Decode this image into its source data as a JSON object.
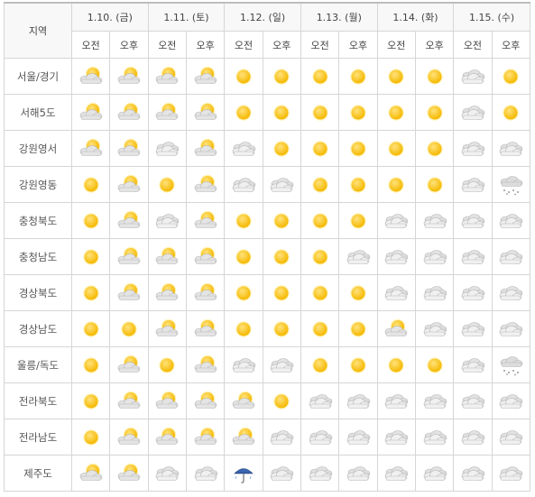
{
  "header": {
    "region_label": "지역",
    "days": [
      "1.10. (금)",
      "1.11. (토)",
      "1.12. (일)",
      "1.13. (월)",
      "1.14. (화)",
      "1.15. (수)"
    ],
    "am_label": "오전",
    "pm_label": "오후"
  },
  "icon_legend": {
    "sun": "sun-icon",
    "partly": "partly-cloudy-icon",
    "cloudy": "cloudy-icon",
    "snow": "snow-cloud-icon",
    "rain": "rain-umbrella-icon"
  },
  "colors": {
    "sun": "#f5b800",
    "cloud": "#d8d8d8",
    "border": "#d6d6d6",
    "umbrella": "#3a66b0"
  },
  "rows": [
    {
      "region": "서울/경기",
      "cells": [
        "partly",
        "partly",
        "partly",
        "partly",
        "sun",
        "sun",
        "sun",
        "sun",
        "sun",
        "sun",
        "cloudy",
        "sun"
      ]
    },
    {
      "region": "서해5도",
      "cells": [
        "partly",
        "partly",
        "partly",
        "partly",
        "sun",
        "sun",
        "sun",
        "sun",
        "sun",
        "sun",
        "cloudy",
        "sun"
      ]
    },
    {
      "region": "강원영서",
      "cells": [
        "partly",
        "partly",
        "cloudy",
        "partly",
        "cloudy",
        "sun",
        "sun",
        "sun",
        "sun",
        "sun",
        "cloudy",
        "cloudy"
      ]
    },
    {
      "region": "강원영동",
      "cells": [
        "sun",
        "partly",
        "sun",
        "partly",
        "cloudy",
        "cloudy",
        "sun",
        "sun",
        "sun",
        "sun",
        "cloudy",
        "snow"
      ]
    },
    {
      "region": "충청북도",
      "cells": [
        "sun",
        "partly",
        "cloudy",
        "partly",
        "sun",
        "sun",
        "sun",
        "sun",
        "cloudy",
        "cloudy",
        "cloudy",
        "cloudy"
      ]
    },
    {
      "region": "충청남도",
      "cells": [
        "sun",
        "partly",
        "partly",
        "partly",
        "sun",
        "sun",
        "sun",
        "cloudy",
        "cloudy",
        "cloudy",
        "cloudy",
        "cloudy"
      ]
    },
    {
      "region": "경상북도",
      "cells": [
        "sun",
        "partly",
        "partly",
        "partly",
        "sun",
        "sun",
        "sun",
        "sun",
        "cloudy",
        "cloudy",
        "cloudy",
        "cloudy"
      ]
    },
    {
      "region": "경상남도",
      "cells": [
        "sun",
        "sun",
        "partly",
        "partly",
        "sun",
        "sun",
        "sun",
        "sun",
        "partly",
        "cloudy",
        "cloudy",
        "cloudy"
      ]
    },
    {
      "region": "울릉/독도",
      "cells": [
        "sun",
        "partly",
        "sun",
        "partly",
        "cloudy",
        "cloudy",
        "sun",
        "sun",
        "sun",
        "sun",
        "cloudy",
        "snow"
      ]
    },
    {
      "region": "전라북도",
      "cells": [
        "sun",
        "partly",
        "partly",
        "partly",
        "partly",
        "sun",
        "cloudy",
        "cloudy",
        "cloudy",
        "cloudy",
        "cloudy",
        "cloudy"
      ]
    },
    {
      "region": "전라남도",
      "cells": [
        "sun",
        "partly",
        "partly",
        "partly",
        "partly",
        "cloudy",
        "cloudy",
        "cloudy",
        "cloudy",
        "cloudy",
        "cloudy",
        "cloudy"
      ]
    },
    {
      "region": "제주도",
      "cells": [
        "partly",
        "partly",
        "cloudy",
        "cloudy",
        "rain",
        "cloudy",
        "cloudy",
        "cloudy",
        "cloudy",
        "cloudy",
        "cloudy",
        "cloudy"
      ]
    }
  ]
}
